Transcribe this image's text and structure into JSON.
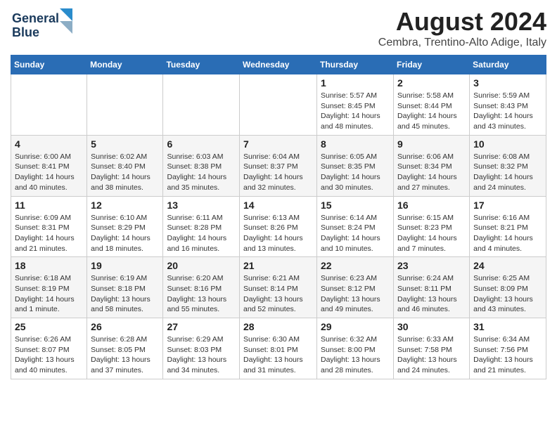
{
  "logo": {
    "line1": "General",
    "line2": "Blue"
  },
  "title": "August 2024",
  "location": "Cembra, Trentino-Alto Adige, Italy",
  "days_of_week": [
    "Sunday",
    "Monday",
    "Tuesday",
    "Wednesday",
    "Thursday",
    "Friday",
    "Saturday"
  ],
  "weeks": [
    [
      {
        "day": "",
        "info": ""
      },
      {
        "day": "",
        "info": ""
      },
      {
        "day": "",
        "info": ""
      },
      {
        "day": "",
        "info": ""
      },
      {
        "day": "1",
        "info": "Sunrise: 5:57 AM\nSunset: 8:45 PM\nDaylight: 14 hours\nand 48 minutes."
      },
      {
        "day": "2",
        "info": "Sunrise: 5:58 AM\nSunset: 8:44 PM\nDaylight: 14 hours\nand 45 minutes."
      },
      {
        "day": "3",
        "info": "Sunrise: 5:59 AM\nSunset: 8:43 PM\nDaylight: 14 hours\nand 43 minutes."
      }
    ],
    [
      {
        "day": "4",
        "info": "Sunrise: 6:00 AM\nSunset: 8:41 PM\nDaylight: 14 hours\nand 40 minutes."
      },
      {
        "day": "5",
        "info": "Sunrise: 6:02 AM\nSunset: 8:40 PM\nDaylight: 14 hours\nand 38 minutes."
      },
      {
        "day": "6",
        "info": "Sunrise: 6:03 AM\nSunset: 8:38 PM\nDaylight: 14 hours\nand 35 minutes."
      },
      {
        "day": "7",
        "info": "Sunrise: 6:04 AM\nSunset: 8:37 PM\nDaylight: 14 hours\nand 32 minutes."
      },
      {
        "day": "8",
        "info": "Sunrise: 6:05 AM\nSunset: 8:35 PM\nDaylight: 14 hours\nand 30 minutes."
      },
      {
        "day": "9",
        "info": "Sunrise: 6:06 AM\nSunset: 8:34 PM\nDaylight: 14 hours\nand 27 minutes."
      },
      {
        "day": "10",
        "info": "Sunrise: 6:08 AM\nSunset: 8:32 PM\nDaylight: 14 hours\nand 24 minutes."
      }
    ],
    [
      {
        "day": "11",
        "info": "Sunrise: 6:09 AM\nSunset: 8:31 PM\nDaylight: 14 hours\nand 21 minutes."
      },
      {
        "day": "12",
        "info": "Sunrise: 6:10 AM\nSunset: 8:29 PM\nDaylight: 14 hours\nand 18 minutes."
      },
      {
        "day": "13",
        "info": "Sunrise: 6:11 AM\nSunset: 8:28 PM\nDaylight: 14 hours\nand 16 minutes."
      },
      {
        "day": "14",
        "info": "Sunrise: 6:13 AM\nSunset: 8:26 PM\nDaylight: 14 hours\nand 13 minutes."
      },
      {
        "day": "15",
        "info": "Sunrise: 6:14 AM\nSunset: 8:24 PM\nDaylight: 14 hours\nand 10 minutes."
      },
      {
        "day": "16",
        "info": "Sunrise: 6:15 AM\nSunset: 8:23 PM\nDaylight: 14 hours\nand 7 minutes."
      },
      {
        "day": "17",
        "info": "Sunrise: 6:16 AM\nSunset: 8:21 PM\nDaylight: 14 hours\nand 4 minutes."
      }
    ],
    [
      {
        "day": "18",
        "info": "Sunrise: 6:18 AM\nSunset: 8:19 PM\nDaylight: 14 hours\nand 1 minute."
      },
      {
        "day": "19",
        "info": "Sunrise: 6:19 AM\nSunset: 8:18 PM\nDaylight: 13 hours\nand 58 minutes."
      },
      {
        "day": "20",
        "info": "Sunrise: 6:20 AM\nSunset: 8:16 PM\nDaylight: 13 hours\nand 55 minutes."
      },
      {
        "day": "21",
        "info": "Sunrise: 6:21 AM\nSunset: 8:14 PM\nDaylight: 13 hours\nand 52 minutes."
      },
      {
        "day": "22",
        "info": "Sunrise: 6:23 AM\nSunset: 8:12 PM\nDaylight: 13 hours\nand 49 minutes."
      },
      {
        "day": "23",
        "info": "Sunrise: 6:24 AM\nSunset: 8:11 PM\nDaylight: 13 hours\nand 46 minutes."
      },
      {
        "day": "24",
        "info": "Sunrise: 6:25 AM\nSunset: 8:09 PM\nDaylight: 13 hours\nand 43 minutes."
      }
    ],
    [
      {
        "day": "25",
        "info": "Sunrise: 6:26 AM\nSunset: 8:07 PM\nDaylight: 13 hours\nand 40 minutes."
      },
      {
        "day": "26",
        "info": "Sunrise: 6:28 AM\nSunset: 8:05 PM\nDaylight: 13 hours\nand 37 minutes."
      },
      {
        "day": "27",
        "info": "Sunrise: 6:29 AM\nSunset: 8:03 PM\nDaylight: 13 hours\nand 34 minutes."
      },
      {
        "day": "28",
        "info": "Sunrise: 6:30 AM\nSunset: 8:01 PM\nDaylight: 13 hours\nand 31 minutes."
      },
      {
        "day": "29",
        "info": "Sunrise: 6:32 AM\nSunset: 8:00 PM\nDaylight: 13 hours\nand 28 minutes."
      },
      {
        "day": "30",
        "info": "Sunrise: 6:33 AM\nSunset: 7:58 PM\nDaylight: 13 hours\nand 24 minutes."
      },
      {
        "day": "31",
        "info": "Sunrise: 6:34 AM\nSunset: 7:56 PM\nDaylight: 13 hours\nand 21 minutes."
      }
    ]
  ]
}
